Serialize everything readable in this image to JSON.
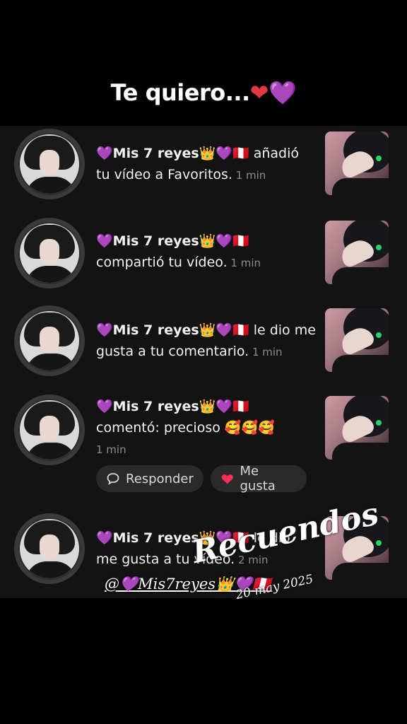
{
  "caption": {
    "text": "Te quiero...",
    "emoji_1": "❤",
    "emoji_2": "💜"
  },
  "notifications": [
    {
      "user": "💜Mis 7 reyes👑💜🇵🇪",
      "action": " añadió tu vídeo a Favoritos.",
      "time": " 1 min"
    },
    {
      "user": "💜Mis 7 reyes👑💜🇵🇪",
      "action": " compartió tu vídeo.",
      "time": " 1 min"
    },
    {
      "user": "💜Mis 7 reyes👑💜🇵🇪",
      "action": " le dio me gusta a tu comentario.",
      "time": " 1 min"
    },
    {
      "user": "💜Mis 7 reyes👑💜🇵🇪",
      "action": " comentó: precioso 🥰🥰🥰",
      "time": "1 min"
    },
    {
      "user": "💜Mis 7 reyes👑💜🇵🇪",
      "action": " le dio me gusta a tu vídeo.",
      "time": " 2 min"
    }
  ],
  "buttons": {
    "reply": "Responder",
    "like": "Me gusta"
  },
  "overlay": {
    "handle": "@💜Mis7reyes👑💜🇵🇪",
    "title": "Recuendos",
    "date": "20 may 2025"
  }
}
